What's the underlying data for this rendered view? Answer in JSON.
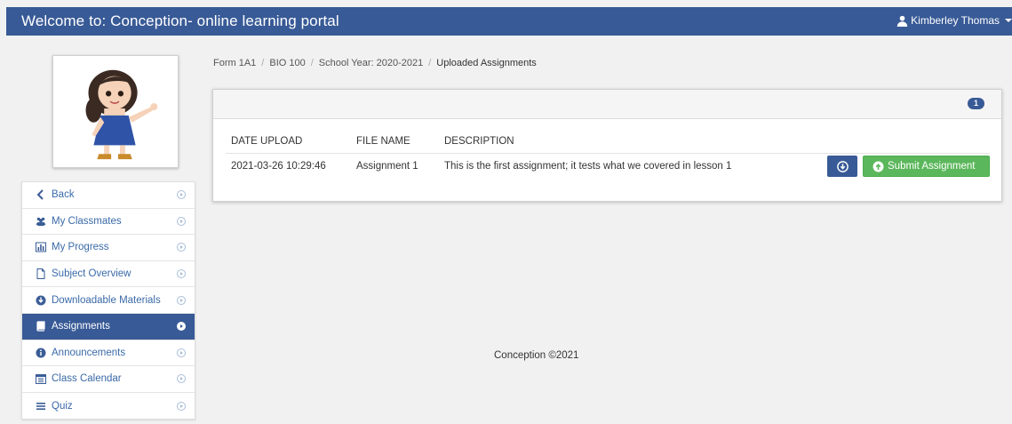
{
  "header": {
    "title": "Welcome to: Conception- online learning portal",
    "user_name": "Kimberley Thomas"
  },
  "sidebar": {
    "items": [
      {
        "label": "Back",
        "icon": "chevron-left-icon"
      },
      {
        "label": "My Classmates",
        "icon": "users-icon"
      },
      {
        "label": "My Progress",
        "icon": "bar-chart-icon"
      },
      {
        "label": "Subject Overview",
        "icon": "file-icon"
      },
      {
        "label": "Downloadable Materials",
        "icon": "download-circle-icon"
      },
      {
        "label": "Assignments",
        "icon": "book-icon",
        "active": true
      },
      {
        "label": "Announcements",
        "icon": "info-icon"
      },
      {
        "label": "Class Calendar",
        "icon": "calendar-icon"
      },
      {
        "label": "Quiz",
        "icon": "list-icon"
      }
    ]
  },
  "breadcrumb": [
    "Form 1A1",
    "BIO 100",
    "School Year: 2020-2021",
    "Uploaded Assignments"
  ],
  "panel": {
    "count_badge": "1",
    "columns": [
      "DATE UPLOAD",
      "FILE NAME",
      "DESCRIPTION"
    ],
    "rows": [
      {
        "date_upload": "2021-03-26 10:29:46",
        "file_name": "Assignment 1",
        "description": "This is the first assignment; it tests what we covered in lesson 1",
        "submit_label": "Submit Assignment"
      }
    ]
  },
  "footer": {
    "text": "Conception ©2021"
  },
  "colors": {
    "brand": "#385a96",
    "success": "#5bb75b"
  }
}
